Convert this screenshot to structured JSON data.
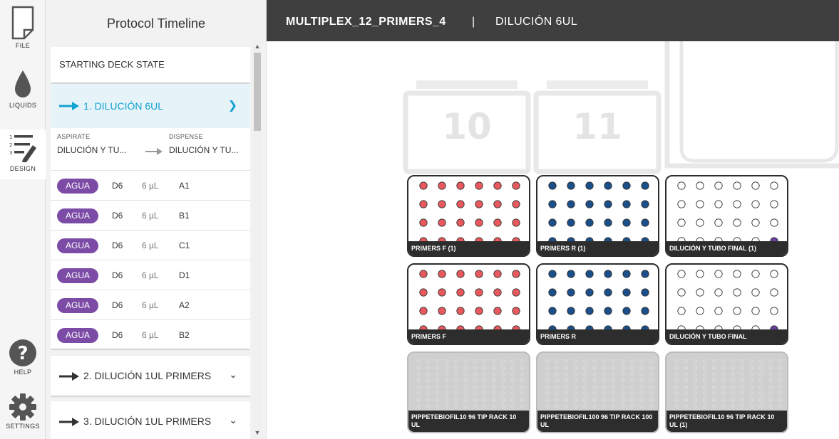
{
  "nav": {
    "file": "FILE",
    "liquids": "LIQUIDS",
    "design": "DESIGN",
    "help": "HELP",
    "settings": "SETTINGS"
  },
  "sidebar": {
    "title": "Protocol Timeline",
    "starting_state": "STARTING DECK STATE",
    "steps": [
      {
        "title": "1. DILUCIÓN 6UL",
        "aspirate_label": "ASPIRATE",
        "aspirate_value": "DILUCIÓN Y TU...",
        "dispense_label": "DISPENSE",
        "dispense_value": "DILUCIÓN Y TU...",
        "rows": [
          {
            "liquid": "AGUA",
            "source": "D6",
            "volume": "6 µL",
            "dest": "A1"
          },
          {
            "liquid": "AGUA",
            "source": "D6",
            "volume": "6 µL",
            "dest": "B1"
          },
          {
            "liquid": "AGUA",
            "source": "D6",
            "volume": "6 µL",
            "dest": "C1"
          },
          {
            "liquid": "AGUA",
            "source": "D6",
            "volume": "6 µL",
            "dest": "D1"
          },
          {
            "liquid": "AGUA",
            "source": "D6",
            "volume": "6 µL",
            "dest": "A2"
          },
          {
            "liquid": "AGUA",
            "source": "D6",
            "volume": "6 µL",
            "dest": "B2"
          }
        ]
      },
      {
        "title": "2. DILUCIÓN 1UL PRIMERS"
      },
      {
        "title": "3. DILUCIÓN 1UL PRIMERS"
      }
    ]
  },
  "header": {
    "protocol_name": "MULTIPLEX_12_PRIMERS_4",
    "separator": "|",
    "step_name": "DILUCIÓN 6UL"
  },
  "deck": {
    "slot_numbers": [
      "10",
      "11"
    ],
    "labware": [
      {
        "label": "PRIMERS F (1)",
        "fill": "red"
      },
      {
        "label": "PRIMERS R (1)",
        "fill": "blue"
      },
      {
        "label": "DILUCIÓN Y TUBO FINAL (1)",
        "fill": "empty"
      },
      {
        "label": "PRIMERS F",
        "fill": "red"
      },
      {
        "label": "PRIMERS R",
        "fill": "blue"
      },
      {
        "label": "DILUCIÓN Y TUBO FINAL",
        "fill": "empty"
      },
      {
        "label": "PIPPETEBIOFIL10 96 TIP RACK 10 UL",
        "fill": "tips"
      },
      {
        "label": "PIPPETEBIOFIL100 96 TIP RACK 100 UL",
        "fill": "tips"
      },
      {
        "label": "PIPPETEBIOFIL10 96 TIP RACK 10 UL (1)",
        "fill": "tips"
      }
    ]
  },
  "colors": {
    "accent": "#13a3d0",
    "liquid_pill": "#7b4ba6",
    "well_red": "#e8595d",
    "well_blue": "#1b4f8a",
    "highlight_well": "#6a3fa0",
    "header_bg": "#3f3f3f"
  }
}
